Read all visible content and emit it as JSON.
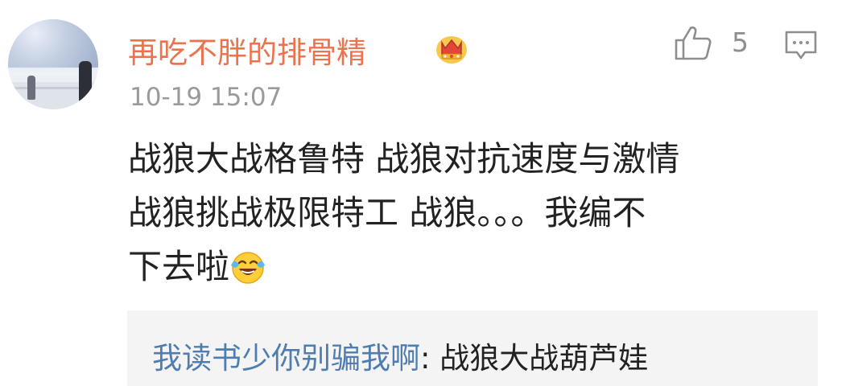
{
  "comment": {
    "username": "再吃不胖的排骨精",
    "timestamp": "10-19 15:07",
    "like_count": "5",
    "lines": [
      "战狼大战格鲁特 战狼对抗速度与激情",
      "战狼挑战极限特工 战狼。。。我编不",
      "下去啦"
    ],
    "emoji": "laughing-crying-emoji",
    "badge": "crown-icon"
  },
  "reply": {
    "username": "我读书少你别骗我啊",
    "separator": ":",
    "text": " 战狼大战葫芦娃"
  },
  "colors": {
    "username": "#eb7350",
    "reply_username": "#507daf",
    "meta": "#9a9a9a",
    "reply_bg": "#f4f4f4"
  }
}
